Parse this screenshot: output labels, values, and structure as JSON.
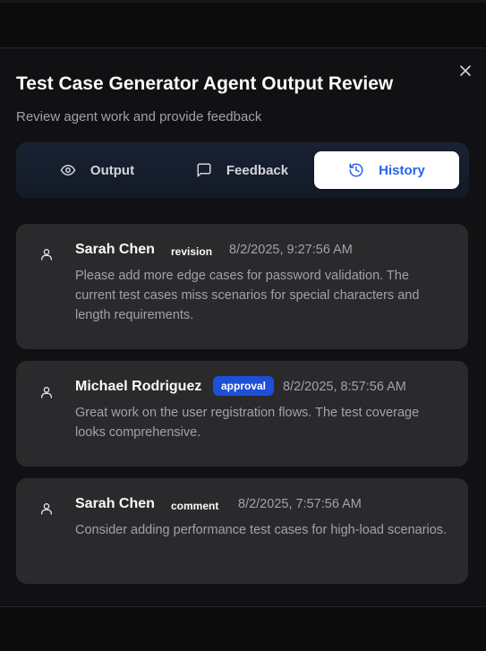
{
  "dialog": {
    "title": "Test Case Generator Agent Output Review",
    "subtitle": "Review agent work and provide feedback",
    "close_icon": "close-icon"
  },
  "tabs": [
    {
      "label": "Output",
      "icon": "eye-icon",
      "active": false
    },
    {
      "label": "Feedback",
      "icon": "message-square-icon",
      "active": false
    },
    {
      "label": "History",
      "icon": "history-icon",
      "active": true
    }
  ],
  "colors": {
    "accent": "#2563eb",
    "badge_approval_bg": "#1d4fd8",
    "card_bg": "#2a2a2c"
  },
  "history": [
    {
      "author": "Sarah Chen",
      "type": "revision",
      "timestamp": "8/2/2025, 9:27:56 AM",
      "message": "Please add more edge cases for password validation. The current test cases miss scenarios for special characters and length requirements."
    },
    {
      "author": "Michael Rodriguez",
      "type": "approval",
      "timestamp": "8/2/2025, 8:57:56 AM",
      "message": "Great work on the user registration flows. The test coverage looks comprehensive."
    },
    {
      "author": "Sarah Chen",
      "type": "comment",
      "timestamp": "8/2/2025, 7:57:56 AM",
      "message": "Consider adding performance test cases for high-load scenarios."
    }
  ]
}
